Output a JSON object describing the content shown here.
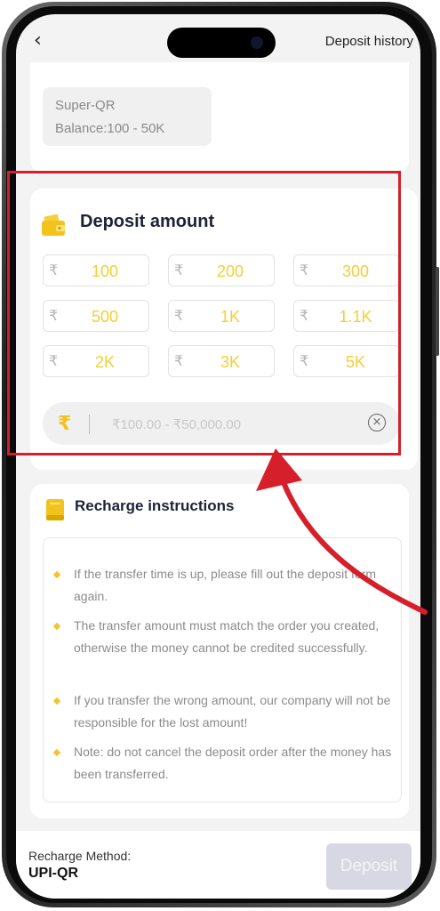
{
  "header": {
    "back_glyph": "‹",
    "history_label": "Deposit history"
  },
  "channel": {
    "name": "Super-QR",
    "balance": "Balance:100 - 50K"
  },
  "deposit": {
    "title": "Deposit amount",
    "currency_symbol": "₹",
    "amounts": [
      "100",
      "200",
      "300",
      "500",
      "1K",
      "1.1K",
      "2K",
      "3K",
      "5K"
    ],
    "input_placeholder": "₹100.00 - ₹50,000.00",
    "input_value": ""
  },
  "instructions": {
    "title": "Recharge instructions",
    "items": [
      "If the transfer time is up, please fill out the deposit form again.",
      "The transfer amount must match the order you created, otherwise the money cannot be credited successfully.",
      "If you transfer the wrong amount, our company will not be responsible for the lost amount!",
      "Note: do not cancel the deposit order after the money has been transferred."
    ]
  },
  "footer": {
    "method_label": "Recharge Method:",
    "method_value": "UPI-QR",
    "deposit_label": "Deposit"
  },
  "colors": {
    "accent_yellow": "#f2cf33",
    "highlight_red": "#d51f2a",
    "title_dark": "#1e2235",
    "button_disabled": "#d7d8e3"
  },
  "icons": [
    "back-icon",
    "wallet-icon",
    "rupee-icon",
    "clear-icon",
    "book-icon",
    "annotation-arrow"
  ]
}
